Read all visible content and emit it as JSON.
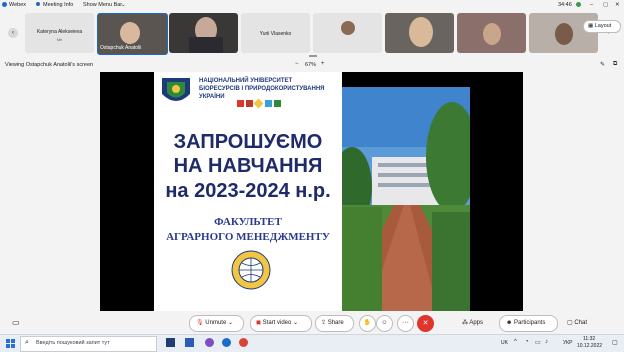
{
  "app": {
    "name": "Webex",
    "meeting_info": "Meeting Info",
    "show_menu_bar": "Show Menu Bar",
    "timer": "34:46"
  },
  "participants": [
    {
      "name": "Kateryna Alekseieva",
      "sub": "Me"
    },
    {
      "name": "Ostapchuk Anatolii"
    },
    {
      "name": ""
    },
    {
      "name": "Yurii Vlasenko"
    },
    {
      "name": ""
    },
    {
      "name": ""
    },
    {
      "name": ""
    },
    {
      "name": ""
    }
  ],
  "layout_label": "Layout",
  "viewing": {
    "label": "Viewing Ostapchuk Anatolii's screen",
    "zoom": "67%",
    "zoom_minus": "−",
    "zoom_plus": "+"
  },
  "slide": {
    "uni_line1": "НАЦІОНАЛЬНИЙ УНІВЕРСИТЕТ",
    "uni_line2": "БІОРЕСУРСІВ І ПРИРОДОКОРИСТУВАННЯ",
    "uni_line3": "УКРАЇНИ",
    "headline1": "ЗАПРОШУЄМО",
    "headline2": "НА НАВЧАННЯ",
    "headline3": "на 2023-2024 н.р.",
    "faculty1": "ФАКУЛЬТЕТ",
    "faculty2": "АГРАРНОГО МЕНЕДЖМЕНТУ"
  },
  "controls": {
    "unmute": "Unmute",
    "start_video": "Start video",
    "share": "Share",
    "apps": "Apps",
    "participants": "Participants",
    "chat": "Chat"
  },
  "taskbar": {
    "search_placeholder": "Введіть пошуковий запит тут",
    "lang1": "UK",
    "lang2": "УКР",
    "time": "11:32",
    "date": "10.12.2022"
  },
  "colors": {
    "accent": "#1f2a6b",
    "red": "#e0352b",
    "webex_blue": "#1b6ac9"
  }
}
